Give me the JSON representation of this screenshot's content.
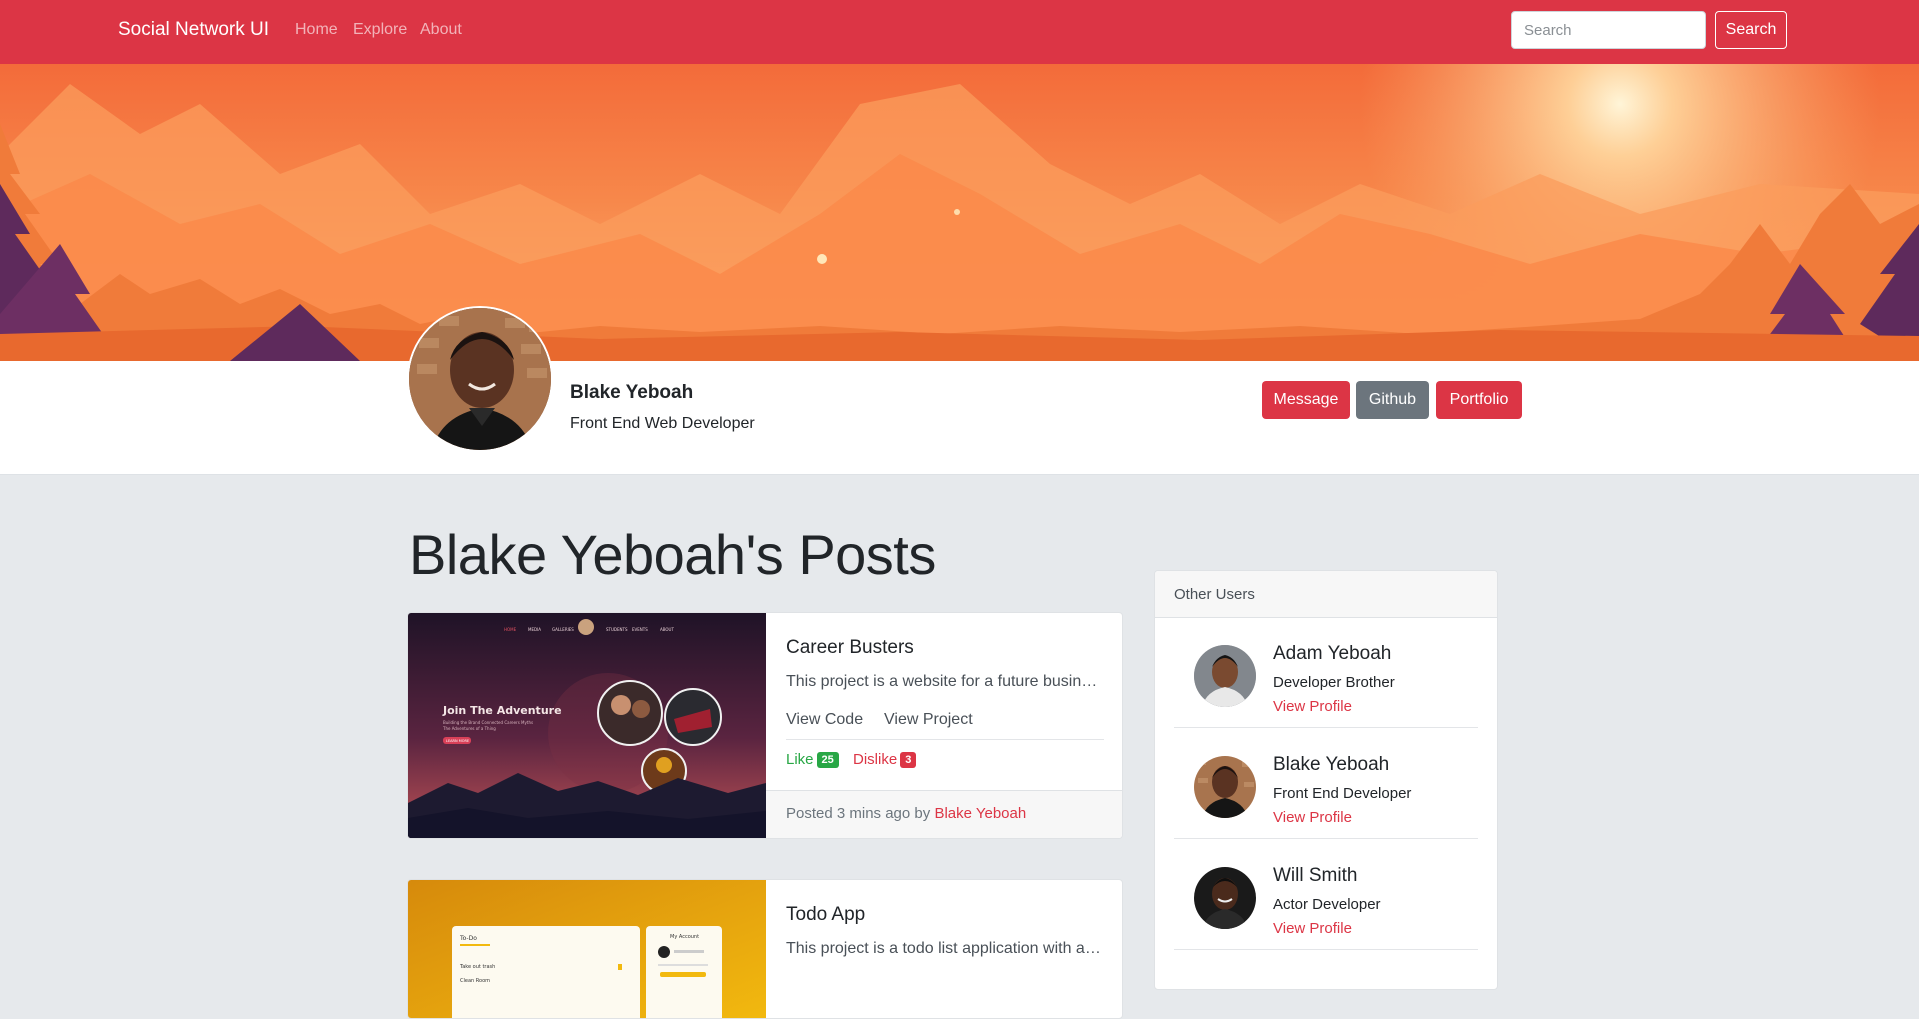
{
  "navbar": {
    "brand": "Social Network UI",
    "links": [
      "Home",
      "Explore",
      "About"
    ],
    "search_placeholder": "Search",
    "search_button": "Search",
    "color": "#dc3545"
  },
  "profile": {
    "name": "Blake Yeboah",
    "title": "Front End Web Developer",
    "buttons": {
      "message": "Message",
      "github": "Github",
      "portfolio": "Portfolio"
    }
  },
  "posts": {
    "heading": "Blake Yeboah's Posts",
    "items": [
      {
        "title": "Career Busters",
        "description": "This project is a website for a future business...",
        "view_code": "View Code",
        "view_project": "View Project",
        "like_label": "Like",
        "like_count": "25",
        "dislike_label": "Dislike",
        "dislike_count": "3",
        "posted_prefix": "Posted 3 mins ago by",
        "author": "Blake Yeboah",
        "thumbnail": {
          "nav": [
            "HOME",
            "MEDIA",
            "GALLERIES",
            "STUDENTS",
            "EVENTS",
            "ABOUT"
          ],
          "headline": "Join The Adventure",
          "subline_1": "Building the Brand Connected Careers Myths",
          "subline_2": "The Adventures of a Thing",
          "button": "LEARN MORE"
        }
      },
      {
        "title": "Todo App",
        "description": "This project is a todo list application with au...",
        "thumbnail": {
          "left_title": "To-Do",
          "left_item_1": "Take out trash",
          "left_item_2": "Clean Room",
          "right_title": "My Account"
        }
      }
    ]
  },
  "sidebar": {
    "header": "Other Users",
    "users": [
      {
        "name": "Adam Yeboah",
        "role": "Developer Brother",
        "link": "View Profile"
      },
      {
        "name": "Blake Yeboah",
        "role": "Front End Developer",
        "link": "View Profile"
      },
      {
        "name": "Will Smith",
        "role": "Actor Developer",
        "link": "View Profile"
      }
    ]
  },
  "colors": {
    "primary": "#dc3545",
    "secondary": "#6c757d",
    "success": "#28a745",
    "page_bg": "#e6e9ec"
  }
}
